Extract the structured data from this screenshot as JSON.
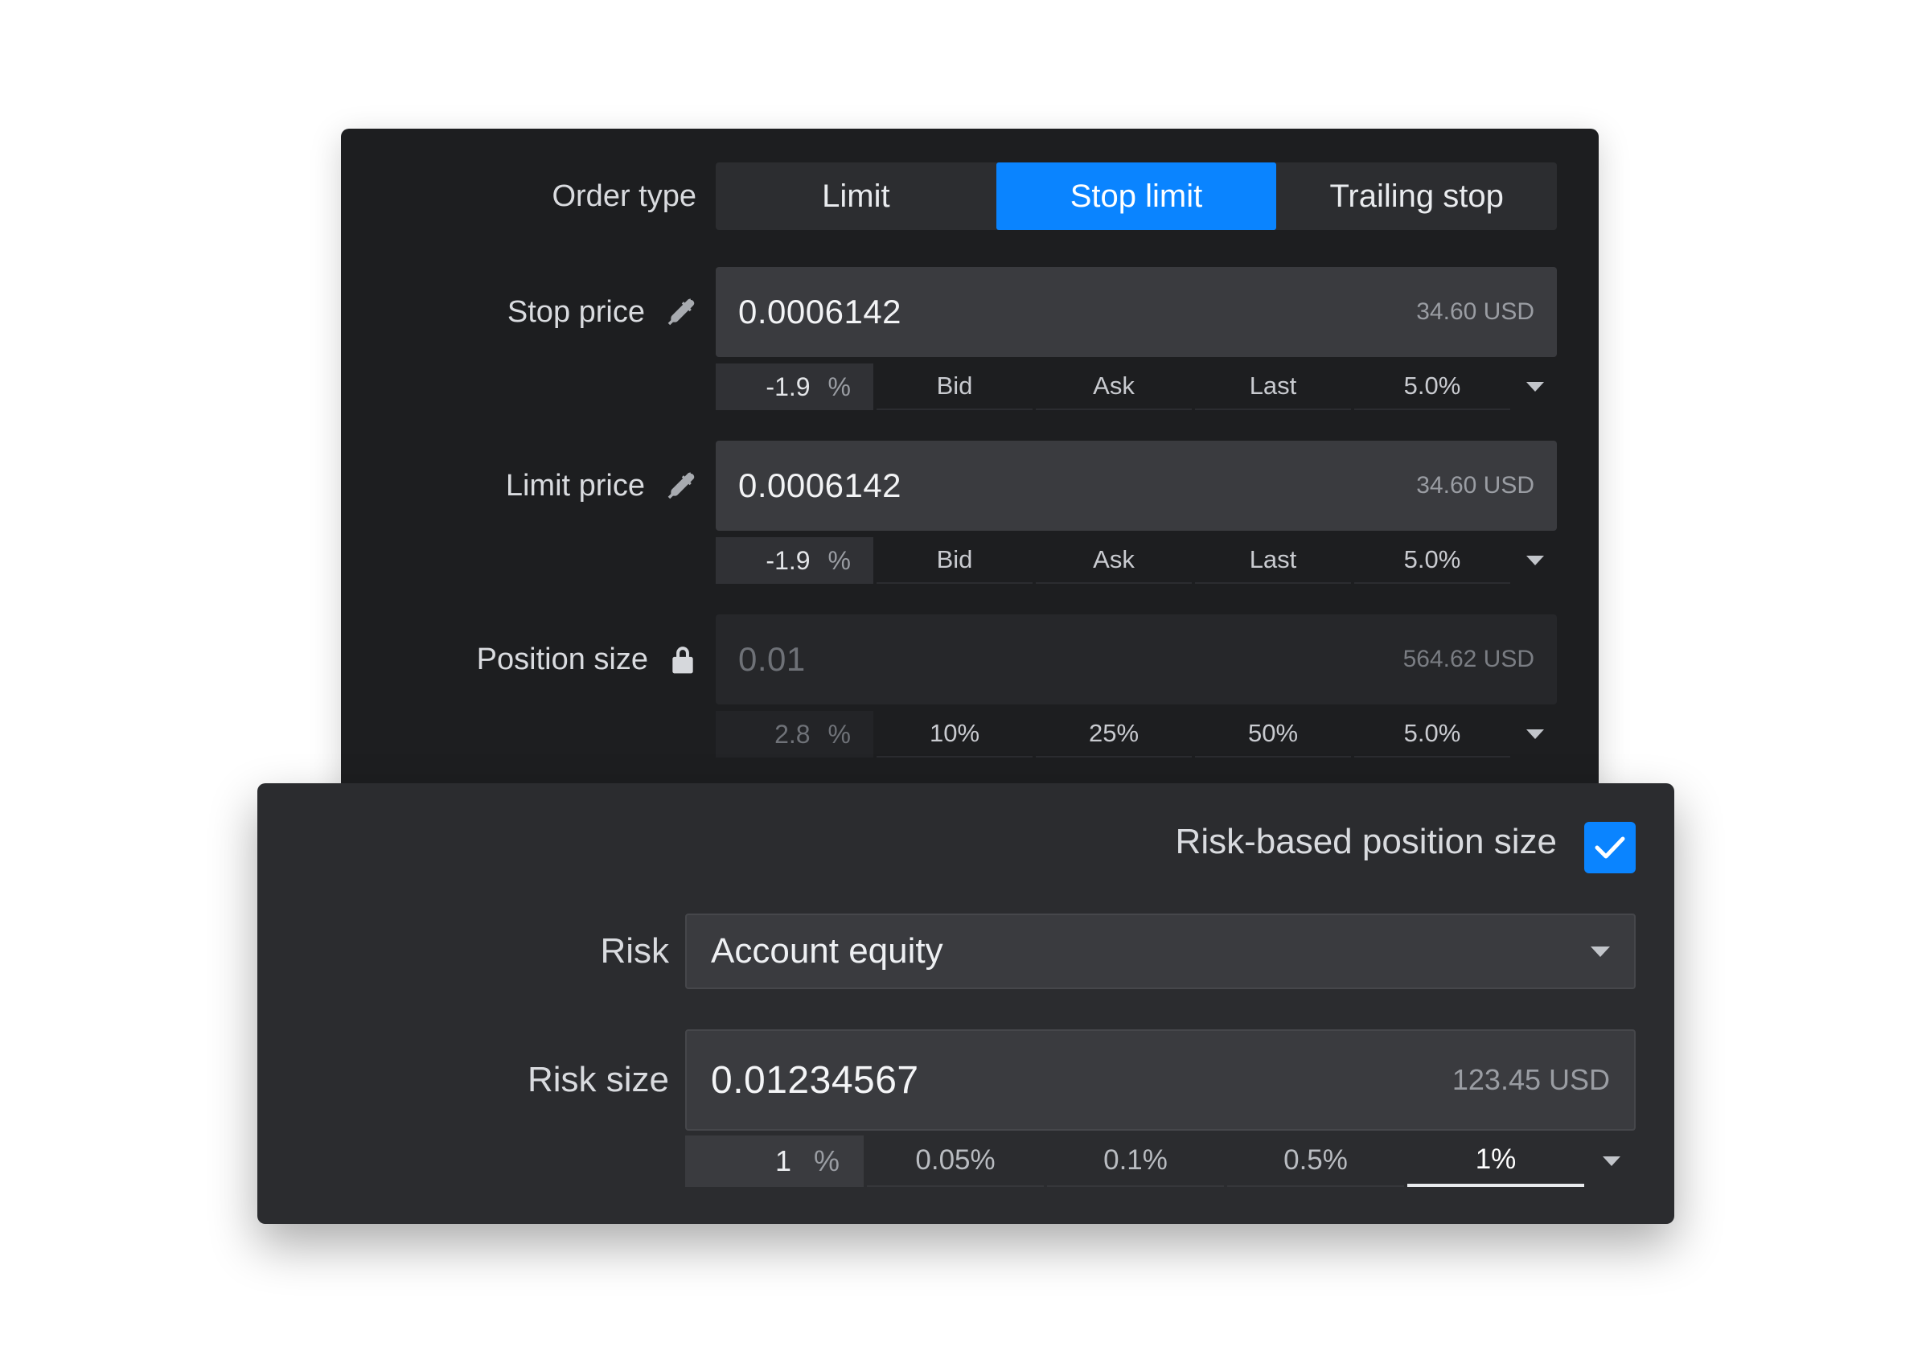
{
  "order_type": {
    "label": "Order type",
    "options": [
      "Limit",
      "Stop limit",
      "Trailing stop"
    ],
    "selected": "Stop limit"
  },
  "stop_price": {
    "label": "Stop price",
    "icon": "eyedropper-icon",
    "value": "0.0006142",
    "usd": "34.60 USD",
    "pct_value": "-1.9",
    "pct_symbol": "%",
    "quick": [
      "Bid",
      "Ask",
      "Last",
      "5.0%"
    ]
  },
  "limit_price": {
    "label": "Limit price",
    "icon": "eyedropper-icon",
    "value": "0.0006142",
    "usd": "34.60 USD",
    "pct_value": "-1.9",
    "pct_symbol": "%",
    "quick": [
      "Bid",
      "Ask",
      "Last",
      "5.0%"
    ]
  },
  "position_size": {
    "label": "Position size",
    "icon": "lock-icon",
    "value": "0.01",
    "usd": "564.62 USD",
    "pct_value": "2.8",
    "pct_symbol": "%",
    "quick": [
      "10%",
      "25%",
      "50%",
      "5.0%"
    ]
  },
  "risk_panel": {
    "risk_based_label": "Risk-based position size",
    "risk_based_checked": true,
    "risk_label": "Risk",
    "risk_selected": "Account equity",
    "risk_size_label": "Risk size",
    "risk_size_value": "0.01234567",
    "risk_size_usd": "123.45 USD",
    "pct_value": "1",
    "pct_symbol": "%",
    "quick": [
      "0.05%",
      "0.1%",
      "0.5%",
      "1%"
    ],
    "quick_selected": "1%"
  },
  "colors": {
    "accent": "#0a84ff",
    "panel_dark": "#1d1e20",
    "panel_mid": "#2b2c2f"
  }
}
